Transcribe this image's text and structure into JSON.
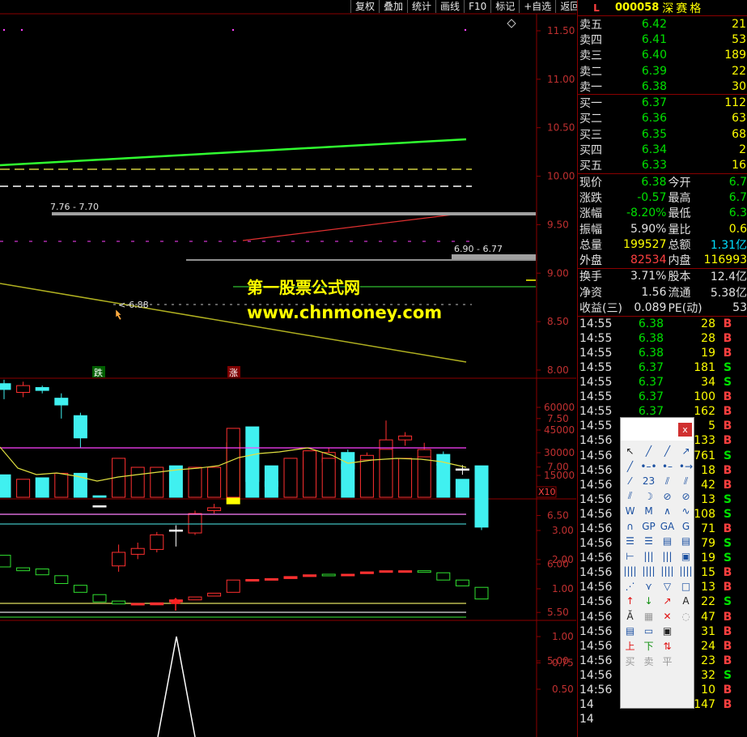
{
  "toolbar": [
    "复权",
    "叠加",
    "统计",
    "画线",
    "F10",
    "标记",
    "+自选",
    "返回"
  ],
  "stock": {
    "flag": "L",
    "code": "000058",
    "name": "深赛格"
  },
  "asks": [
    {
      "label": "卖五",
      "price": "6.42",
      "vol": "21"
    },
    {
      "label": "卖四",
      "price": "6.41",
      "vol": "53"
    },
    {
      "label": "卖三",
      "price": "6.40",
      "vol": "189"
    },
    {
      "label": "卖二",
      "price": "6.39",
      "vol": "22"
    },
    {
      "label": "卖一",
      "price": "6.38",
      "vol": "30"
    }
  ],
  "bids": [
    {
      "label": "买一",
      "price": "6.37",
      "vol": "112"
    },
    {
      "label": "买二",
      "price": "6.36",
      "vol": "63"
    },
    {
      "label": "买三",
      "price": "6.35",
      "vol": "68"
    },
    {
      "label": "买四",
      "price": "6.34",
      "vol": "2"
    },
    {
      "label": "买五",
      "price": "6.33",
      "vol": "16"
    }
  ],
  "stats1": [
    {
      "k1": "现价",
      "v1": "6.38",
      "c1": "c-green",
      "k2": "今开",
      "v2": "6.7",
      "c2": "c-green"
    },
    {
      "k1": "涨跌",
      "v1": "-0.57",
      "c1": "c-green",
      "k2": "最高",
      "v2": "6.7",
      "c2": "c-green"
    },
    {
      "k1": "涨幅",
      "v1": "-8.20%",
      "c1": "c-green",
      "k2": "最低",
      "v2": "6.3",
      "c2": "c-green"
    },
    {
      "k1": "振幅",
      "v1": "5.90%",
      "c1": "c-white",
      "k2": "量比",
      "v2": "0.6",
      "c2": "c-yellow"
    },
    {
      "k1": "总量",
      "v1": "199527",
      "c1": "c-yellow",
      "k2": "总额",
      "v2": "1.31亿",
      "c2": "c-cyan"
    },
    {
      "k1": "外盘",
      "v1": "82534",
      "c1": "c-red",
      "k2": "内盘",
      "v2": "116993",
      "c2": "c-yellow"
    }
  ],
  "stats2": [
    {
      "k1": "换手",
      "v1": "3.71%",
      "c1": "c-white",
      "k2": "股本",
      "v2": "12.4亿",
      "c2": "c-white"
    },
    {
      "k1": "净资",
      "v1": "1.56",
      "c1": "c-white",
      "k2": "流通",
      "v2": "5.38亿",
      "c2": "c-white"
    },
    {
      "k1": "收益(三)",
      "v1": "0.089",
      "c1": "c-white",
      "k2": "PE(动)",
      "v2": "53",
      "c2": "c-white"
    }
  ],
  "ticks": [
    {
      "t": "14:55",
      "p": "6.38",
      "pc": "c-green",
      "v": "28",
      "bs": "B",
      "bc": "c-red"
    },
    {
      "t": "14:55",
      "p": "6.38",
      "pc": "c-green",
      "v": "28",
      "bs": "B",
      "bc": "c-red"
    },
    {
      "t": "14:55",
      "p": "6.38",
      "pc": "c-green",
      "v": "19",
      "bs": "B",
      "bc": "c-red"
    },
    {
      "t": "14:55",
      "p": "6.37",
      "pc": "c-green",
      "v": "181",
      "bs": "S",
      "bc": "c-green"
    },
    {
      "t": "14:55",
      "p": "6.37",
      "pc": "c-green",
      "v": "34",
      "bs": "S",
      "bc": "c-green"
    },
    {
      "t": "14:55",
      "p": "6.37",
      "pc": "c-green",
      "v": "100",
      "bs": "B",
      "bc": "c-red"
    },
    {
      "t": "14:55",
      "p": "6.37",
      "pc": "c-green",
      "v": "162",
      "bs": "B",
      "bc": "c-red"
    },
    {
      "t": "14:55",
      "p": "",
      "pc": "c-green",
      "v": "5",
      "bs": "B",
      "bc": "c-red"
    },
    {
      "t": "14:56",
      "p": "",
      "pc": "c-green",
      "v": "133",
      "bs": "B",
      "bc": "c-red"
    },
    {
      "t": "14:56",
      "p": "",
      "pc": "c-green",
      "v": "761",
      "bs": "S",
      "bc": "c-green"
    },
    {
      "t": "14:56",
      "p": "",
      "pc": "c-green",
      "v": "18",
      "bs": "B",
      "bc": "c-red"
    },
    {
      "t": "14:56",
      "p": "",
      "pc": "c-green",
      "v": "42",
      "bs": "B",
      "bc": "c-red"
    },
    {
      "t": "14:56",
      "p": "",
      "pc": "c-green",
      "v": "13",
      "bs": "S",
      "bc": "c-green"
    },
    {
      "t": "14:56",
      "p": "",
      "pc": "c-green",
      "v": "108",
      "bs": "S",
      "bc": "c-green"
    },
    {
      "t": "14:56",
      "p": "",
      "pc": "c-green",
      "v": "71",
      "bs": "B",
      "bc": "c-red"
    },
    {
      "t": "14:56",
      "p": "",
      "pc": "c-green",
      "v": "79",
      "bs": "S",
      "bc": "c-green"
    },
    {
      "t": "14:56",
      "p": "",
      "pc": "c-green",
      "v": "19",
      "bs": "S",
      "bc": "c-green"
    },
    {
      "t": "14:56",
      "p": "",
      "pc": "c-green",
      "v": "15",
      "bs": "B",
      "bc": "c-red"
    },
    {
      "t": "14:56",
      "p": "",
      "pc": "c-green",
      "v": "13",
      "bs": "B",
      "bc": "c-red"
    },
    {
      "t": "14:56",
      "p": "",
      "pc": "c-green",
      "v": "22",
      "bs": "S",
      "bc": "c-green"
    },
    {
      "t": "14:56",
      "p": "",
      "pc": "c-green",
      "v": "47",
      "bs": "B",
      "bc": "c-red"
    },
    {
      "t": "14:56",
      "p": "",
      "pc": "c-green",
      "v": "31",
      "bs": "B",
      "bc": "c-red"
    },
    {
      "t": "14:56",
      "p": "",
      "pc": "c-green",
      "v": "24",
      "bs": "B",
      "bc": "c-red"
    },
    {
      "t": "14:56",
      "p": "",
      "pc": "c-green",
      "v": "23",
      "bs": "B",
      "bc": "c-red"
    },
    {
      "t": "14:56",
      "p": "",
      "pc": "c-green",
      "v": "32",
      "bs": "S",
      "bc": "c-green"
    },
    {
      "t": "14:56",
      "p": "",
      "pc": "c-green",
      "v": "10",
      "bs": "B",
      "bc": "c-red"
    },
    {
      "t": "14",
      "p": "",
      "pc": "c-green",
      "v": "147",
      "bs": "B",
      "bc": "c-red"
    },
    {
      "t": "14",
      "p": "",
      "pc": "c-green",
      "v": "",
      "bs": "",
      "bc": "c-red"
    }
  ],
  "price_axis": [
    "11.50",
    "11.00",
    "10.50",
    "10.00",
    "9.50",
    "9.00",
    "8.50",
    "8.00",
    "7.50",
    "7.00",
    "6.50",
    "6.00",
    "5.50",
    "5.00"
  ],
  "volume_axis": [
    "60000",
    "45000",
    "30000",
    "15000"
  ],
  "volume_unit": "X10",
  "ind1_axis": [
    "3.00",
    "2.00",
    "1.00"
  ],
  "ind2_axis": [
    "1.00",
    "0.75",
    "0.50"
  ],
  "annotations": {
    "range_high": "7.76 - 7.70",
    "range_right": "6.90 - 6.77",
    "low_mark": "6.88",
    "down_tag": "跌",
    "up_tag": "涨"
  },
  "watermark": {
    "title": "第一股票公式网",
    "url": "www.chnmoney.com"
  },
  "palette": {
    "close": "x",
    "tools": [
      {
        "g": "↖",
        "c": "dark"
      },
      {
        "g": "╱",
        "c": ""
      },
      {
        "g": "╱",
        "c": ""
      },
      {
        "g": "↗",
        "c": ""
      },
      {
        "g": "╱",
        "c": ""
      },
      {
        "g": "•–•",
        "c": ""
      },
      {
        "g": "•–",
        "c": ""
      },
      {
        "g": "•→",
        "c": ""
      },
      {
        "g": "⁄",
        "c": ""
      },
      {
        "g": "23",
        "c": ""
      },
      {
        "g": "⫽",
        "c": ""
      },
      {
        "g": "⫽",
        "c": ""
      },
      {
        "g": "⫽",
        "c": ""
      },
      {
        "g": "☽",
        "c": ""
      },
      {
        "g": "⊘",
        "c": ""
      },
      {
        "g": "⊘",
        "c": ""
      },
      {
        "g": "W",
        "c": ""
      },
      {
        "g": "M",
        "c": ""
      },
      {
        "g": "∧",
        "c": ""
      },
      {
        "g": "∿",
        "c": ""
      },
      {
        "g": "∩",
        "c": ""
      },
      {
        "g": "GP",
        "c": ""
      },
      {
        "g": "GA",
        "c": ""
      },
      {
        "g": "G",
        "c": ""
      },
      {
        "g": "☰",
        "c": ""
      },
      {
        "g": "☰",
        "c": ""
      },
      {
        "g": "▤",
        "c": ""
      },
      {
        "g": "▤",
        "c": ""
      },
      {
        "g": "⊢",
        "c": ""
      },
      {
        "g": "|||",
        "c": ""
      },
      {
        "g": "|||",
        "c": ""
      },
      {
        "g": "▣",
        "c": ""
      },
      {
        "g": "||||",
        "c": ""
      },
      {
        "g": "||||",
        "c": ""
      },
      {
        "g": "||||",
        "c": ""
      },
      {
        "g": "||||",
        "c": ""
      },
      {
        "g": "⋰",
        "c": ""
      },
      {
        "g": "⋎",
        "c": ""
      },
      {
        "g": "▽",
        "c": ""
      },
      {
        "g": "□",
        "c": ""
      },
      {
        "g": "↑",
        "c": "red"
      },
      {
        "g": "↓",
        "c": "green"
      },
      {
        "g": "↗",
        "c": "red"
      },
      {
        "g": "A",
        "c": "dark"
      },
      {
        "g": "Ă",
        "c": "dark"
      },
      {
        "g": "▦",
        "c": "grey"
      },
      {
        "g": "✕",
        "c": "red"
      },
      {
        "g": "◌",
        "c": "grey"
      },
      {
        "g": "▤",
        "c": ""
      },
      {
        "g": "▭",
        "c": ""
      },
      {
        "g": "▣",
        "c": "dark"
      },
      {
        "g": "",
        "c": ""
      },
      {
        "g": "上",
        "c": "red"
      },
      {
        "g": "下",
        "c": "green"
      },
      {
        "g": "⇅",
        "c": "red"
      },
      {
        "g": "",
        "c": ""
      },
      {
        "g": "买",
        "c": "grey"
      },
      {
        "g": "卖",
        "c": "grey"
      },
      {
        "g": "平",
        "c": "grey"
      },
      {
        "g": "",
        "c": ""
      }
    ]
  },
  "chart_data": {
    "type": "candlestick",
    "candles": [
      {
        "o": 7.8,
        "c": 7.86,
        "h": 7.9,
        "l": 7.7,
        "col": "cyan"
      },
      {
        "o": 7.77,
        "c": 7.84,
        "h": 7.88,
        "l": 7.72,
        "col": "red"
      },
      {
        "o": 7.82,
        "c": 7.79,
        "h": 7.84,
        "l": 7.76,
        "col": "cyan"
      },
      {
        "o": 7.71,
        "c": 7.64,
        "h": 7.76,
        "l": 7.5,
        "col": "cyan"
      },
      {
        "o": 7.53,
        "c": 7.3,
        "h": 7.56,
        "l": 7.2,
        "col": "cyan"
      },
      {
        "o": 6.6,
        "c": 6.6,
        "h": 6.6,
        "l": 6.6,
        "col": "white"
      },
      {
        "o": 5.98,
        "c": 6.12,
        "h": 6.2,
        "l": 5.92,
        "col": "red"
      },
      {
        "o": 6.1,
        "c": 6.16,
        "h": 6.22,
        "l": 6.05,
        "col": "red"
      },
      {
        "o": 6.15,
        "c": 6.3,
        "h": 6.33,
        "l": 6.12,
        "col": "red"
      },
      {
        "o": 6.35,
        "c": 6.35,
        "h": 6.4,
        "l": 6.18,
        "col": "white"
      },
      {
        "o": 6.32,
        "c": 6.52,
        "h": 6.55,
        "l": 6.3,
        "col": "red"
      },
      {
        "o": 6.55,
        "c": 6.58,
        "h": 6.62,
        "l": 6.52,
        "col": "red"
      },
      {
        "o": 6.62,
        "c": 7.25,
        "h": 7.25,
        "l": 6.62,
        "col": "yellow"
      },
      {
        "o": 7.17,
        "c": 6.85,
        "h": 7.22,
        "l": 6.8,
        "col": "cyan"
      },
      {
        "o": 6.85,
        "c": 6.8,
        "h": 6.92,
        "l": 6.72,
        "col": "cyan"
      },
      {
        "o": 6.8,
        "c": 7.0,
        "h": 7.05,
        "l": 6.78,
        "col": "red"
      },
      {
        "o": 6.98,
        "c": 7.1,
        "h": 7.15,
        "l": 6.95,
        "col": "red"
      },
      {
        "o": 7.05,
        "c": 7.15,
        "h": 7.2,
        "l": 7.0,
        "col": "red"
      },
      {
        "o": 7.15,
        "c": 6.98,
        "h": 7.18,
        "l": 6.95,
        "col": "cyan"
      },
      {
        "o": 6.98,
        "c": 7.12,
        "h": 7.15,
        "l": 6.95,
        "col": "red"
      },
      {
        "o": 7.1,
        "c": 7.28,
        "h": 7.48,
        "l": 7.08,
        "col": "red"
      },
      {
        "o": 7.28,
        "c": 7.32,
        "h": 7.36,
        "l": 7.22,
        "col": "red"
      },
      {
        "o": 7.08,
        "c": 7.18,
        "h": 7.25,
        "l": 7.02,
        "col": "red"
      },
      {
        "o": 7.13,
        "c": 7.02,
        "h": 7.16,
        "l": 7.0,
        "col": "cyan"
      },
      {
        "o": 6.98,
        "c": 6.98,
        "h": 7.02,
        "l": 6.92,
        "col": "white"
      },
      {
        "o": 6.82,
        "c": 6.38,
        "h": 6.82,
        "l": 6.35,
        "col": "cyan"
      }
    ],
    "volumes": [
      {
        "v": 15000,
        "col": "cyan"
      },
      {
        "v": 12000,
        "col": "red"
      },
      {
        "v": 13000,
        "col": "cyan"
      },
      {
        "v": 16000,
        "col": "red"
      },
      {
        "v": 16000,
        "col": "cyan"
      },
      {
        "v": 1000,
        "col": "cyan"
      },
      {
        "v": 26000,
        "col": "red"
      },
      {
        "v": 20000,
        "col": "red"
      },
      {
        "v": 20000,
        "col": "red"
      },
      {
        "v": 21000,
        "col": "cyan"
      },
      {
        "v": 20000,
        "col": "red"
      },
      {
        "v": 20000,
        "col": "red"
      },
      {
        "v": 46000,
        "col": "red"
      },
      {
        "v": 47000,
        "col": "cyan"
      },
      {
        "v": 21000,
        "col": "cyan"
      },
      {
        "v": 26000,
        "col": "red"
      },
      {
        "v": 31000,
        "col": "red"
      },
      {
        "v": 26000,
        "col": "red"
      },
      {
        "v": 22000,
        "col": "cyan"
      },
      {
        "v": 25000,
        "col": "red"
      },
      {
        "v": 32000,
        "col": "red"
      },
      {
        "v": 26000,
        "col": "red"
      },
      {
        "v": 27000,
        "col": "red"
      },
      {
        "v": 22000,
        "col": "cyan"
      },
      {
        "v": 12000,
        "col": "cyan"
      },
      {
        "v": 21000,
        "col": "cyan"
      }
    ],
    "ind1": [
      {
        "o": 2.15,
        "c": 1.75,
        "col": "green"
      },
      {
        "o": 1.72,
        "c": 1.62,
        "col": "green"
      },
      {
        "o": 1.68,
        "c": 1.48,
        "col": "green"
      },
      {
        "o": 1.45,
        "c": 1.18,
        "col": "green"
      },
      {
        "o": 1.12,
        "c": 0.88,
        "col": "green"
      },
      {
        "o": 0.8,
        "c": 0.55,
        "col": "green"
      },
      {
        "o": 0.58,
        "c": 0.48,
        "col": "green"
      },
      {
        "o": 0.5,
        "c": 0.45,
        "col": "red"
      },
      {
        "o": 0.45,
        "c": 0.52,
        "col": "red"
      },
      {
        "o": 0.55,
        "c": 0.62,
        "col": "red"
      },
      {
        "o": 0.62,
        "c": 0.72,
        "col": "red"
      },
      {
        "o": 0.75,
        "c": 0.85,
        "col": "red"
      },
      {
        "o": 0.88,
        "c": 1.3,
        "col": "red"
      },
      {
        "o": 1.3,
        "c": 1.32,
        "col": "red"
      },
      {
        "o": 1.32,
        "c": 1.35,
        "col": "red"
      },
      {
        "o": 1.35,
        "c": 1.42,
        "col": "red"
      },
      {
        "o": 1.42,
        "c": 1.48,
        "col": "red"
      },
      {
        "o": 1.48,
        "c": 1.5,
        "col": "green"
      },
      {
        "o": 1.5,
        "c": 1.45,
        "col": "red"
      },
      {
        "o": 1.52,
        "c": 1.58,
        "col": "red"
      },
      {
        "o": 1.58,
        "c": 1.62,
        "col": "red"
      },
      {
        "o": 1.62,
        "c": 1.6,
        "col": "red"
      },
      {
        "o": 1.62,
        "c": 1.6,
        "col": "green"
      },
      {
        "o": 1.55,
        "c": 1.3,
        "col": "green"
      },
      {
        "o": 1.3,
        "c": 1.1,
        "col": "green"
      },
      {
        "o": 1.05,
        "c": 0.65,
        "col": "green"
      }
    ]
  }
}
